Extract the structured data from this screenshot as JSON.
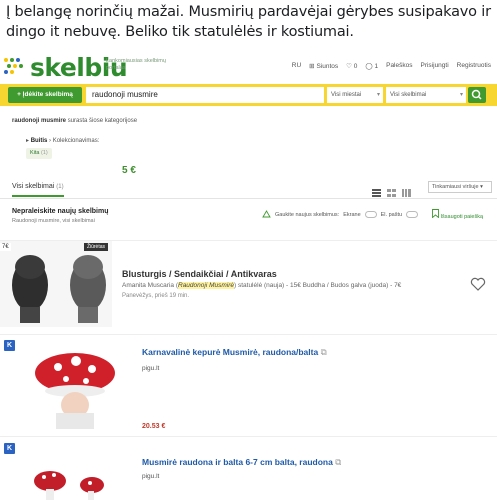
{
  "post": {
    "caption": "Į belangę norinčių mažai. Musmirių pardavėjai gėrybes susipakavo ir dingo it nebuvę. Beliko tik statulėlės ir kostiumai."
  },
  "site": {
    "logo": "skelbiu",
    "tagline": "Lankomiausias skelbimų portalas",
    "nav": [
      "RU",
      "Siuntos",
      "0",
      "1",
      "Paleškos",
      "Prisijungti",
      "Registruotis"
    ]
  },
  "search": {
    "submit_label": "+ Įdėkite skelbimą",
    "query": "raudonoji musmire",
    "city": "Visi miestai",
    "category": "Visi skelbimai"
  },
  "results": {
    "found_query": "raudonoji musmire",
    "found_suffix": "surasta šiose kategorijose",
    "crumb_parent": "Buitis",
    "crumb_child": "Kolekcionavimas:",
    "crumb_pill": "Kita",
    "crumb_pill_count": "(1)"
  },
  "tabs": {
    "all_label": "Visi skelbimai",
    "all_count": "(1)",
    "sort": "Tinkamiausi viršuje"
  },
  "notify": {
    "title": "Nepraleiskite naujų skelbimų",
    "subtitle": "Raudonoji musmire, visi skelbimai",
    "option_label": "Gaukite naujus skelbimus:",
    "opt1": "Ekrane",
    "opt2": "El. paštu",
    "save_label": "Išsaugoti paiešką"
  },
  "listings": [
    {
      "badge": "7€",
      "img_label": "Žiūrėtas",
      "title": "Blusturgis / Sendaikčiai / Antikvaras",
      "desc_before": "Amanita Muscaria (",
      "desc_hl": "Raudonoji Musmirė",
      "desc_after": ") statulėlė (nauja) - 15€ Buddha / Budos galva (juoda) - 7€",
      "location": "Panevėžys, prieš 19 min.",
      "price": "5 €"
    }
  ],
  "k_listings": [
    {
      "badge": "K",
      "title": "Karnavalinė kepurė Musmirė, raudona/balta",
      "source": "pigu.lt",
      "price": "20.53 €"
    },
    {
      "badge": "K",
      "title": "Musmirė raudona ir balta 6-7 cm balta, raudona",
      "source": "pigu.lt",
      "price": ""
    }
  ],
  "colors": {
    "brand_green": "#3f9a2f",
    "search_yellow": "#f7d631",
    "k_blue": "#2b63c3",
    "price_red": "#c0392b"
  }
}
